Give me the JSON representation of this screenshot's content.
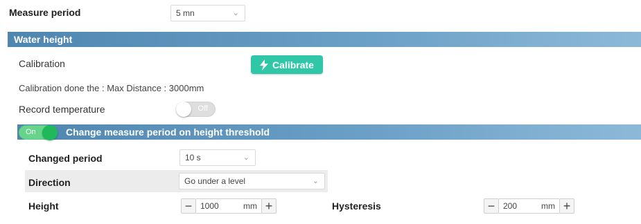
{
  "measure_period": {
    "label": "Measure period",
    "value": "5 mn"
  },
  "water_height": {
    "title": "Water height",
    "calibration_label": "Calibration",
    "calibrate_button": "Calibrate",
    "calibration_info": "Calibration done the : Max Distance : 3000mm",
    "record_temperature": {
      "label": "Record temperature",
      "state": "Off"
    }
  },
  "threshold": {
    "toggle_state": "On",
    "title": "Change measure period on height threshold",
    "changed_period": {
      "label": "Changed period",
      "value": "10 s"
    },
    "direction": {
      "label": "Direction",
      "value": "Go under a level"
    },
    "height": {
      "label": "Height",
      "value": "1000",
      "unit": "mm"
    },
    "hysteresis": {
      "label": "Hysteresis",
      "value": "200",
      "unit": "mm"
    }
  },
  "colors": {
    "header": "#5b90b8",
    "calibrate": "#2fc7a8",
    "toggle_on": "#1fb85a"
  },
  "icons": {
    "calibrate": "lightning-icon",
    "select": "chevron-down-icon",
    "minus": "minus-icon",
    "plus": "plus-icon"
  }
}
